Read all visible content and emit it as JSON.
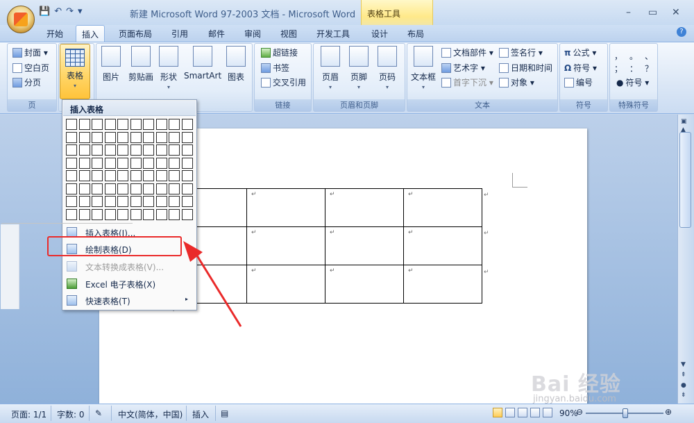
{
  "window": {
    "title": "新建 Microsoft Word 97-2003 文档 - Microsoft Word",
    "context_tools": "表格工具",
    "controls": [
      "–",
      "▭",
      "✕"
    ]
  },
  "qat": {
    "save": "💾",
    "undo": "↶",
    "redo": "↷",
    "customize": "▾"
  },
  "tabs": [
    "开始",
    "插入",
    "页面布局",
    "引用",
    "邮件",
    "审阅",
    "视图",
    "开发工具",
    "设计",
    "布局"
  ],
  "active_tab": "插入",
  "help": "?",
  "ribbon": {
    "pages_group": {
      "label": "页",
      "items": [
        "封面 ▾",
        "空白页",
        "分页"
      ]
    },
    "table_btn": {
      "label": "表格",
      "arrow": "▾"
    },
    "illustrations": [
      "图片",
      "剪贴画",
      "形状",
      "SmartArt",
      "图表"
    ],
    "shapes_arrow": "▾",
    "links_group": {
      "label": "链接",
      "items": [
        "超链接",
        "书签",
        "交叉引用"
      ]
    },
    "header_footer_group": {
      "label": "页眉和页脚",
      "items": [
        "页眉",
        "页脚",
        "页码"
      ]
    },
    "text_group": {
      "label": "文本",
      "textbox": "文本框",
      "items": [
        "文档部件 ▾",
        "艺术字 ▾",
        "首字下沉 ▾",
        "签名行 ▾",
        "日期和时间",
        "对象 ▾"
      ]
    },
    "symbols_group": {
      "label": "符号",
      "items": [
        "公式 ▾",
        "符号 ▾",
        "编号"
      ]
    },
    "special_group": {
      "label": "特殊符号",
      "chars": [
        "，",
        "。",
        "、",
        "；",
        "：",
        "？"
      ],
      "symbol": "符号 ▾"
    }
  },
  "dropdown": {
    "header": "插入表格",
    "grid_rows": 8,
    "grid_cols": 10,
    "items": [
      {
        "label": "插入表格(I)...",
        "disabled": false
      },
      {
        "label": "绘制表格(D)",
        "disabled": false
      },
      {
        "label": "文本转换成表格(V)...",
        "disabled": true
      },
      {
        "label": "Excel 电子表格(X)",
        "disabled": false
      },
      {
        "label": "快速表格(T)",
        "disabled": false,
        "submenu": "▸"
      }
    ]
  },
  "document": {
    "table_rows": 3,
    "table_cols": 4,
    "cell_mark": "↵"
  },
  "statusbar": {
    "page": "页面: 1/1",
    "words": "字数: 0",
    "language": "中文(简体，中国)",
    "mode": "插入",
    "zoom": "90%",
    "minus": "⊖",
    "plus": "⊕"
  },
  "watermark": {
    "brand": "Bai 经验",
    "url": "jingyan.baidu.com"
  },
  "colors": {
    "highlight": "#ea2a2a",
    "ribbon_active": "#ffd76a"
  }
}
